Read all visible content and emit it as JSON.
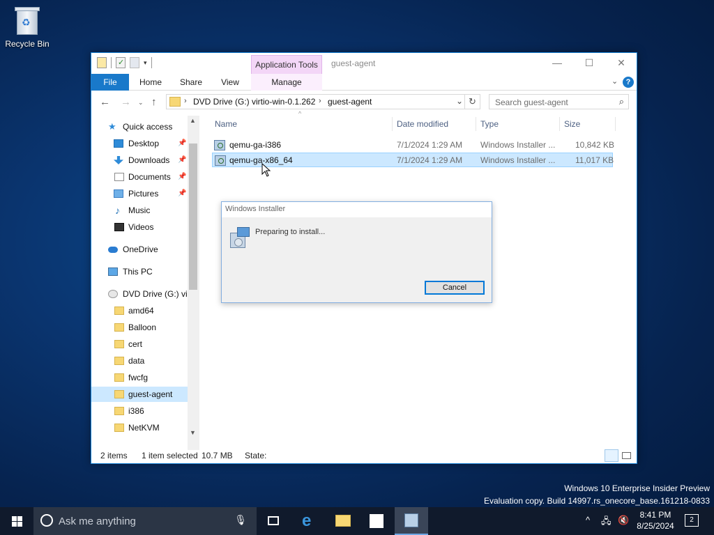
{
  "desktop": {
    "recycle_bin_label": "Recycle Bin",
    "watermark_line1": "Windows 10 Enterprise Insider Preview",
    "watermark_line2": "Evaluation copy. Build 14997.rs_onecore_base.161218-0833"
  },
  "explorer": {
    "title": "guest-agent",
    "context_tab": "Application Tools",
    "ribbon_tabs": [
      "File",
      "Home",
      "Share",
      "View",
      "Manage"
    ],
    "address": {
      "crumbs": [
        "DVD Drive (G:) virtio-win-0.1.262",
        "guest-agent"
      ]
    },
    "search_placeholder": "Search guest-agent",
    "nav": [
      {
        "label": "Quick access",
        "icon": "quick-access-star-icon"
      },
      {
        "label": "Desktop",
        "icon": "desktop-folder-icon",
        "pinned": true
      },
      {
        "label": "Downloads",
        "icon": "downloads-icon",
        "pinned": true
      },
      {
        "label": "Documents",
        "icon": "documents-icon",
        "pinned": true
      },
      {
        "label": "Pictures",
        "icon": "pictures-icon",
        "pinned": true
      },
      {
        "label": "Music",
        "icon": "music-icon"
      },
      {
        "label": "Videos",
        "icon": "videos-icon"
      },
      {
        "label": "OneDrive",
        "icon": "onedrive-icon"
      },
      {
        "label": "This PC",
        "icon": "this-pc-icon"
      },
      {
        "label": "DVD Drive (G:) virt",
        "icon": "dvd-drive-icon"
      },
      {
        "label": "amd64",
        "icon": "folder-icon"
      },
      {
        "label": "Balloon",
        "icon": "folder-icon"
      },
      {
        "label": "cert",
        "icon": "folder-icon"
      },
      {
        "label": "data",
        "icon": "folder-icon"
      },
      {
        "label": "fwcfg",
        "icon": "folder-icon"
      },
      {
        "label": "guest-agent",
        "icon": "folder-icon",
        "selected": true
      },
      {
        "label": "i386",
        "icon": "folder-icon"
      },
      {
        "label": "NetKVM",
        "icon": "folder-icon"
      }
    ],
    "columns": [
      "Name",
      "Date modified",
      "Type",
      "Size"
    ],
    "files": [
      {
        "name": "qemu-ga-i386",
        "date": "7/1/2024 1:29 AM",
        "type": "Windows Installer ...",
        "size": "10,842 KB",
        "selected": false
      },
      {
        "name": "qemu-ga-x86_64",
        "date": "7/1/2024 1:29 AM",
        "type": "Windows Installer ...",
        "size": "11,017 KB",
        "selected": true
      }
    ],
    "status": {
      "items": "2 items",
      "selected": "1 item selected",
      "size": "10.7 MB",
      "state": "State:"
    }
  },
  "dialog": {
    "title": "Windows Installer",
    "message": "Preparing to install...",
    "cancel_label": "Cancel"
  },
  "taskbar": {
    "search_placeholder": "Ask me anything",
    "time": "8:41 PM",
    "date": "8/25/2024",
    "notification_count": "2"
  }
}
